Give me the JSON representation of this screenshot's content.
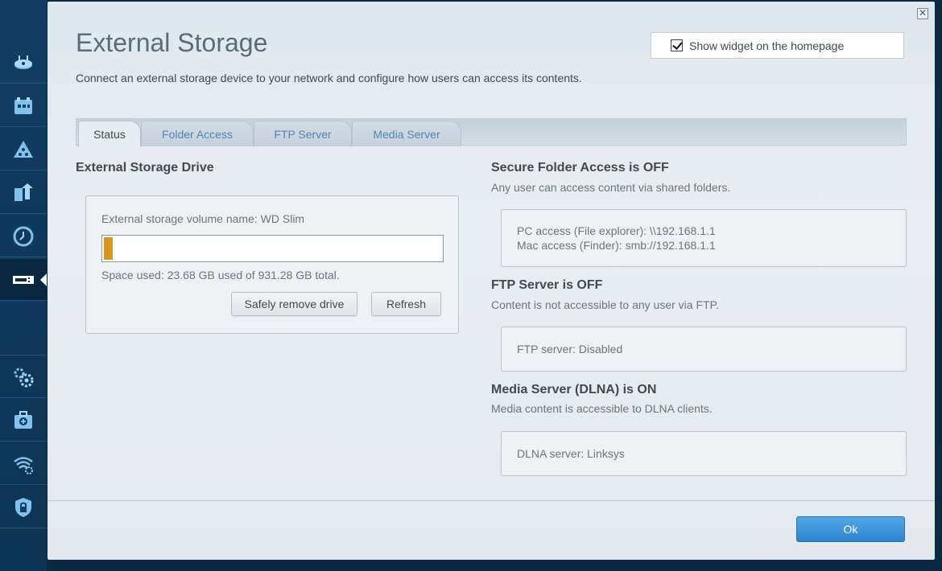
{
  "sidebar": {
    "items": [
      {
        "icon": "router-icon"
      },
      {
        "icon": "devices-icon"
      },
      {
        "icon": "network-map-icon"
      },
      {
        "icon": "priority-icon"
      },
      {
        "icon": "clock-icon"
      },
      {
        "icon": "usb-icon",
        "active": true
      },
      {
        "icon": "settings-gear-icon"
      },
      {
        "icon": "troubleshoot-icon"
      },
      {
        "icon": "wireless-settings-icon"
      },
      {
        "icon": "security-shield-icon"
      }
    ]
  },
  "page": {
    "close_label": "✕",
    "title": "External Storage",
    "description": "Connect an external storage device to your network and configure how users can access its contents.",
    "widget_label": "Show widget on the homepage",
    "widget_checked": true
  },
  "tabs": [
    {
      "label": "Status",
      "active": true
    },
    {
      "label": "Folder Access"
    },
    {
      "label": "FTP Server"
    },
    {
      "label": "Media Server"
    }
  ],
  "drive": {
    "heading": "External Storage Drive",
    "volume_label": "External storage volume name: WD Slim",
    "used_gb": 23.68,
    "total_gb": 931.28,
    "space_text": "Space used: 23.68 GB used of 931.28 GB total.",
    "safely_remove_label": "Safely remove drive",
    "refresh_label": "Refresh",
    "fill_color": "#d8971f"
  },
  "secure_folder": {
    "heading": "Secure Folder Access is OFF",
    "sub": "Any user can access content via shared folders.",
    "pc_access": "PC access (File explorer): \\\\192.168.1.1",
    "mac_access": "Mac access (Finder): smb://192.168.1.1"
  },
  "ftp": {
    "heading": "FTP Server is OFF",
    "sub": "Content is not accessible to any user via FTP.",
    "status": "FTP server: Disabled"
  },
  "dlna": {
    "heading": "Media Server (DLNA) is ON",
    "sub": "Media content is accessible to DLNA clients.",
    "status": "DLNA server: Linksys"
  },
  "footer": {
    "ok_label": "Ok"
  },
  "colors": {
    "accent_blue": "#2a84cf",
    "sidebar_bg": "#123d62",
    "tab_link": "#4e86b8"
  }
}
